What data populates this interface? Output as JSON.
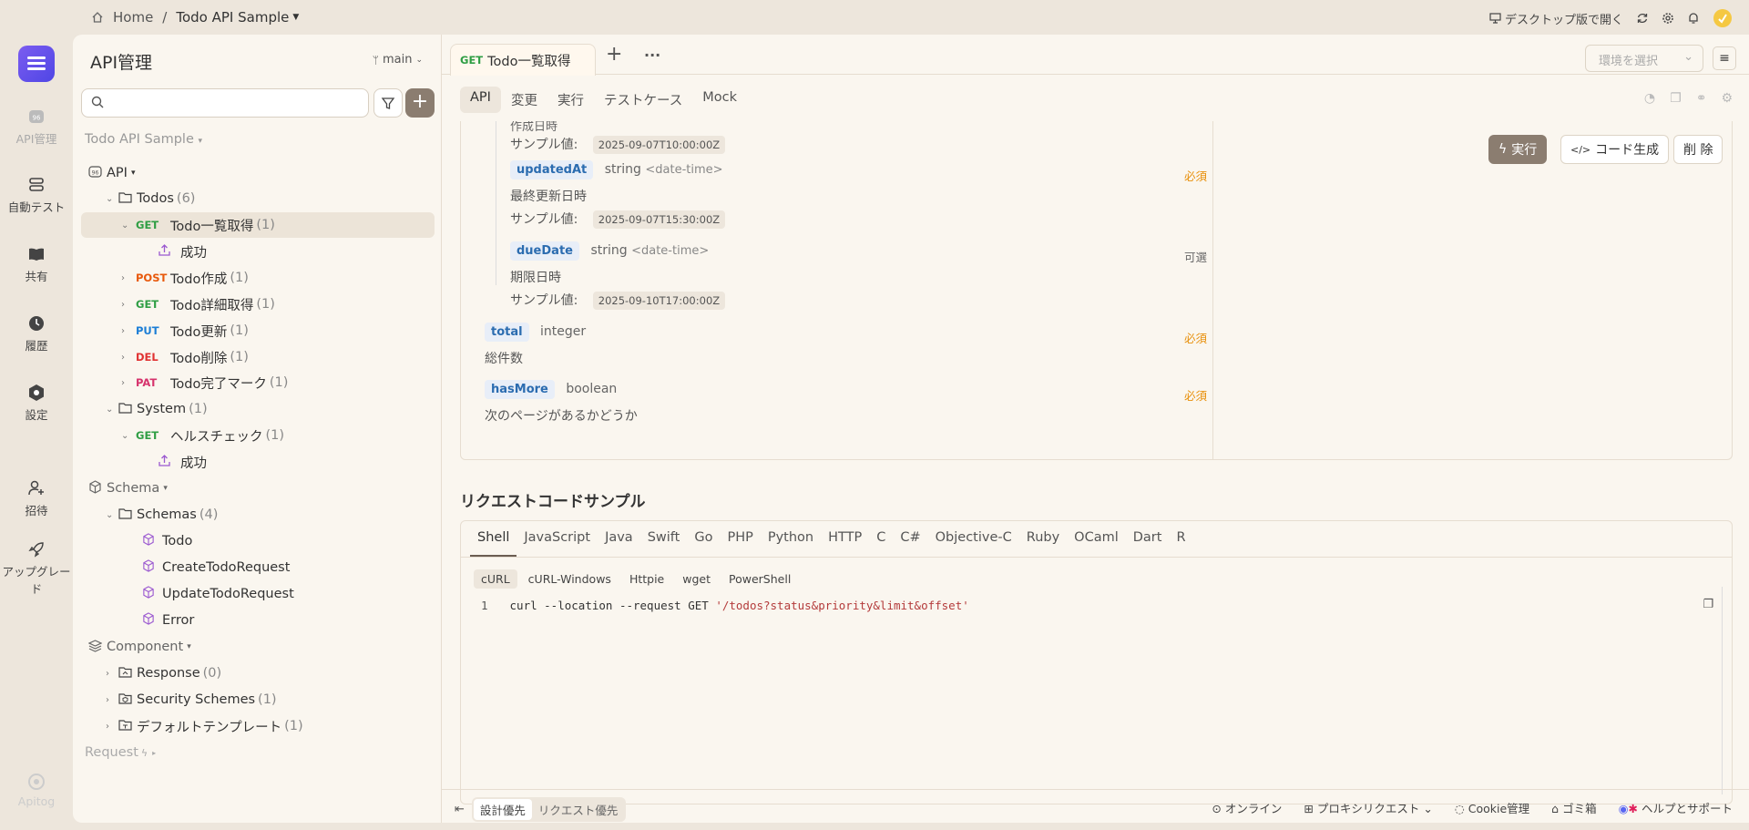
{
  "topbar": {
    "home": "Home",
    "sep": "/",
    "project": "Todo API Sample",
    "desktop_open": "デスクトップ版で開く"
  },
  "rail": {
    "items": [
      {
        "label": "API管理"
      },
      {
        "label": "自動テスト"
      },
      {
        "label": "共有"
      },
      {
        "label": "履歴"
      },
      {
        "label": "設定"
      },
      {
        "label": "招待"
      },
      {
        "label": "アップグレード"
      },
      {
        "label": "Apitog"
      }
    ]
  },
  "sidebar": {
    "title": "API管理",
    "branch": "main",
    "project": "Todo API Sample",
    "tree": [
      {
        "label": "API",
        "count": ""
      },
      {
        "label": "Todos",
        "count": "(6)"
      },
      {
        "method": "GET",
        "label": "Todo一覧取得",
        "count": "(1)"
      },
      {
        "label": "成功",
        "count": ""
      },
      {
        "method": "POST",
        "label": "Todo作成",
        "count": "(1)"
      },
      {
        "method": "GET",
        "label": "Todo詳細取得",
        "count": "(1)"
      },
      {
        "method": "PUT",
        "label": "Todo更新",
        "count": "(1)"
      },
      {
        "method": "DEL",
        "label": "Todo削除",
        "count": "(1)"
      },
      {
        "method": "PAT",
        "label": "Todo完了マーク",
        "count": "(1)"
      },
      {
        "label": "System",
        "count": "(1)"
      },
      {
        "method": "GET",
        "label": "ヘルスチェック",
        "count": "(1)"
      },
      {
        "label": "成功",
        "count": ""
      },
      {
        "label": "Schema",
        "count": ""
      },
      {
        "label": "Schemas",
        "count": "(4)"
      },
      {
        "label": "Todo",
        "count": ""
      },
      {
        "label": "CreateTodoRequest",
        "count": ""
      },
      {
        "label": "UpdateTodoRequest",
        "count": ""
      },
      {
        "label": "Error",
        "count": ""
      },
      {
        "label": "Component",
        "count": ""
      },
      {
        "label": "Response",
        "count": "(0)"
      },
      {
        "label": "Security Schemes",
        "count": "(1)"
      },
      {
        "label": "デフォルトテンプレート",
        "count": "(1)"
      }
    ],
    "request": "Request"
  },
  "tab": {
    "method": "GET",
    "label": "Todo一覧取得",
    "add": "+",
    "more": "···"
  },
  "env_select": {
    "placeholder": "環境を選択"
  },
  "subtabs": [
    "API",
    "変更",
    "実行",
    "テストケース",
    "Mock"
  ],
  "schema": {
    "cut_text": "作成日時",
    "sample_label": "サンプル値:",
    "fields": [
      {
        "sample": "2025-09-07T10:00:00Z"
      },
      {
        "name": "updatedAt",
        "type": "string",
        "format": "<date-time>",
        "req": "必須",
        "desc": "最終更新日時",
        "sample": "2025-09-07T15:30:00Z"
      },
      {
        "name": "dueDate",
        "type": "string",
        "format": "<date-time>",
        "req": "可選",
        "desc": "期限日時",
        "sample": "2025-09-10T17:00:00Z"
      },
      {
        "name": "total",
        "type": "integer",
        "req": "必須",
        "desc": "総件数"
      },
      {
        "name": "hasMore",
        "type": "boolean",
        "req": "必須",
        "desc": "次のページがあるかどうか"
      }
    ]
  },
  "actions": {
    "run": "実行",
    "codegen": "コード生成",
    "delete": "削 除"
  },
  "code_section": {
    "title": "リクエストコードサンプル",
    "langs": [
      "Shell",
      "JavaScript",
      "Java",
      "Swift",
      "Go",
      "PHP",
      "Python",
      "HTTP",
      "C",
      "C#",
      "Objective-C",
      "Ruby",
      "OCaml",
      "Dart",
      "R"
    ],
    "clients": [
      "cURL",
      "cURL-Windows",
      "Httpie",
      "wget",
      "PowerShell"
    ],
    "line_no": "1",
    "code_prefix": "curl --location --request GET ",
    "code_str": "'/todos?status&priority&limit&offset'"
  },
  "footer": {
    "design_first": "設計優先",
    "request_first": "リクエスト優先",
    "online": "オンライン",
    "proxy": "プロキシリクエスト",
    "cookie": "Cookie管理",
    "trash": "ゴミ箱",
    "help": "ヘルプとサポート"
  }
}
